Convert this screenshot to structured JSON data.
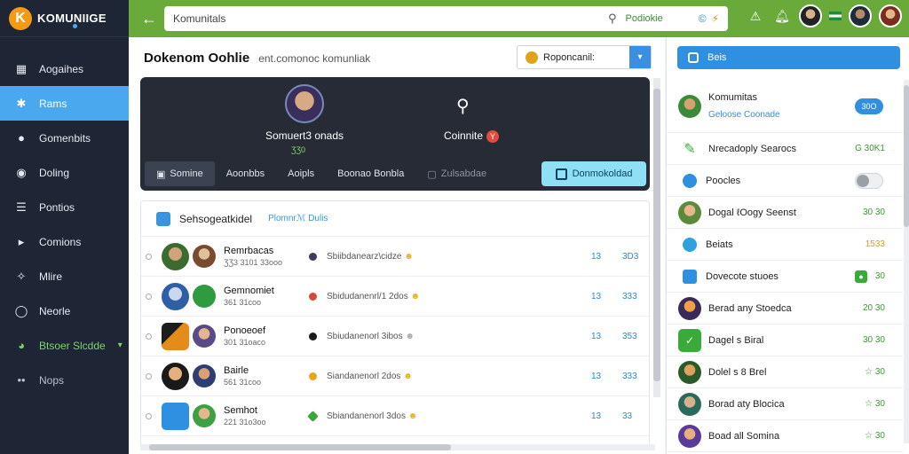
{
  "app": {
    "logo_letter": "K",
    "logo_text": "KOMUNIIGE"
  },
  "sidebar": {
    "items": [
      {
        "label": "Aogaihes",
        "icon": "grid-icon"
      },
      {
        "label": "Rams",
        "icon": "puzzle-icon"
      },
      {
        "label": "Gomenbits",
        "icon": "chat-icon"
      },
      {
        "label": "Doling",
        "icon": "message-icon"
      },
      {
        "label": "Pontios",
        "icon": "list-icon"
      },
      {
        "label": "Comions",
        "icon": "play-icon"
      },
      {
        "label": "Mlire",
        "icon": "star-icon"
      },
      {
        "label": "Neorle",
        "icon": "circle-icon"
      },
      {
        "label": "Btsoer Slcdde",
        "icon": "palette-icon"
      },
      {
        "label": "Nops",
        "icon": "dots-icon"
      }
    ]
  },
  "search": {
    "value": "Komunitals",
    "tag": "Podiokie",
    "tail": "©",
    "tail2": "⚡"
  },
  "page": {
    "title": "Dokenom Oohlie",
    "subtitle": "ent.comonoc komunliak",
    "select_label": "Roponcanil:"
  },
  "profile": {
    "name": "Somuert3 onads",
    "meta": "ƷƷ0",
    "connect_label": "Coinnite",
    "connect_badge": "Y",
    "tabs": [
      "Somine",
      "Aoonbbs",
      "Aoipls",
      "Boonao Bonbla",
      "Zulsabdae"
    ],
    "cta": "Donmokoldad"
  },
  "list": {
    "title": "Sehsogeatkidel",
    "tag": "Plomnrℳ Dulis",
    "rows": [
      {
        "name": "Remrbacas",
        "meta": "ƷƷ3 3101 33ooo",
        "status": "Sbiibdanearz\\cidze",
        "dot": "#3b3b5a",
        "c1": "13",
        "c2": "3D3"
      },
      {
        "name": "Gemnomiet",
        "meta": "361 31coo",
        "status": "Sbidudanenrl/1 2dos",
        "dot": "#d24a3a",
        "c1": "13",
        "c2": "333"
      },
      {
        "name": "Ponoeoef",
        "meta": "301 31oaco",
        "status": "Sbiudanenorl 3ibos",
        "dot": "#1a1a1a",
        "c1": "13",
        "c2": "353"
      },
      {
        "name": "Bairle",
        "meta": "561 31coo",
        "status": "Siandanenorl 2dos",
        "dot": "#e6a51c",
        "c1": "13",
        "c2": "333"
      },
      {
        "name": "Semhot",
        "meta": "221 31o3oo",
        "status": "Sbiandanenorl 3dos",
        "dot": "#38a83d",
        "c1": "13",
        "c2": "33"
      }
    ]
  },
  "right": {
    "button": "Beis",
    "items": [
      {
        "label": "Komumitas",
        "sub": "Geloose Coonade",
        "pill": "30O"
      },
      {
        "label": "Nrecadoply Searocs",
        "val": "G 30K1"
      },
      {
        "label": "Poocles"
      },
      {
        "label": "Dogal ℓOogy Seenst",
        "val": "30 30"
      },
      {
        "label": "Beiats",
        "val": "1533"
      },
      {
        "label": "Dovecote stuoes",
        "val": "30"
      },
      {
        "label": "Berad any Stoedca",
        "val": "20 30"
      },
      {
        "label": "Dagel s Biral",
        "val": "30 30"
      },
      {
        "label": "Dolel s 8 Brel",
        "val": "☆ 30"
      },
      {
        "label": "Borad aty Blocica",
        "val": "☆ 30"
      },
      {
        "label": "Boad all Somina",
        "val": "☆ 30"
      }
    ]
  }
}
